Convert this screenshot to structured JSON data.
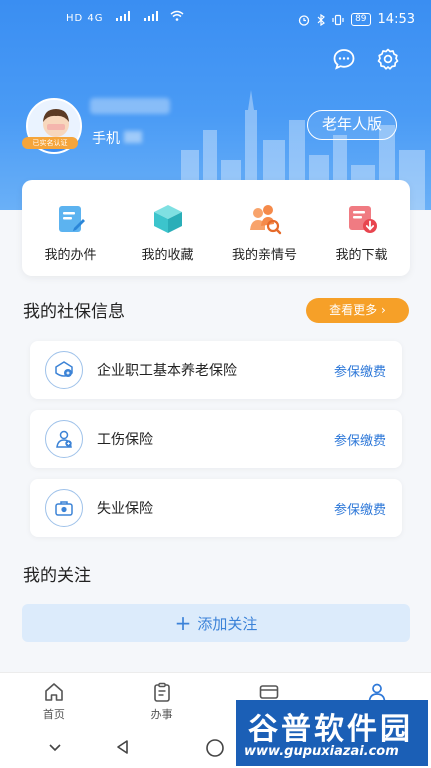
{
  "status_bar": {
    "left_text": "HD 4G",
    "battery": "89",
    "time": "14:53"
  },
  "header": {
    "verified_badge": "已实名认证",
    "phone_label": "手机",
    "elder_mode_label": "老年人版"
  },
  "shortcuts": [
    {
      "label": "我的办件",
      "icon": "document-edit-icon"
    },
    {
      "label": "我的收藏",
      "icon": "cube-icon"
    },
    {
      "label": "我的亲情号",
      "icon": "family-search-icon"
    },
    {
      "label": "我的下载",
      "icon": "download-icon"
    }
  ],
  "social_security": {
    "title": "我的社保信息",
    "more_label": "查看更多",
    "items": [
      {
        "name": "企业职工基本养老保险",
        "action": "参保缴费",
        "icon": "pension-icon"
      },
      {
        "name": "工伤保险",
        "action": "参保缴费",
        "icon": "injury-icon"
      },
      {
        "name": "失业保险",
        "action": "参保缴费",
        "icon": "briefcase-icon"
      }
    ]
  },
  "follow": {
    "title": "我的关注",
    "add_label": "添加关注"
  },
  "tabbar": [
    {
      "label": "首页",
      "icon": "home-icon"
    },
    {
      "label": "办事",
      "icon": "clipboard-icon"
    },
    {
      "label": "",
      "icon": "card-icon"
    },
    {
      "label": "",
      "icon": "user-icon"
    }
  ],
  "watermark": {
    "title": "谷普软件园",
    "url": "www.gupuxiazai.com"
  },
  "colors": {
    "header_blue": "#3a8ef2",
    "accent_orange": "#f6a028",
    "link_blue": "#2e78d8",
    "follow_bg": "#dcebfb"
  }
}
